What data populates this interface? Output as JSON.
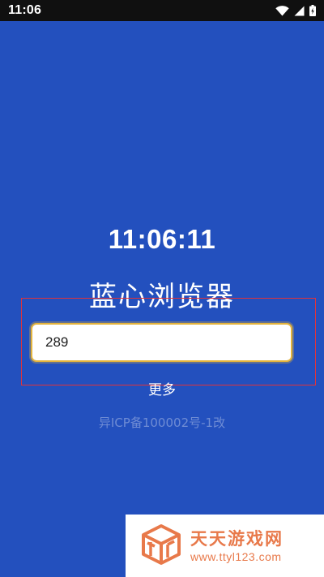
{
  "status_bar": {
    "time": "11:06",
    "icons": [
      "wifi-icon",
      "signal-icon",
      "battery-icon"
    ]
  },
  "main": {
    "clock": "11:06:11",
    "app_title": "蓝心浏览器",
    "search_value": "289",
    "more_label": "更多",
    "icp": "异ICP备100002号-1改"
  },
  "watermark": {
    "name": "天天游戏网",
    "url": "www.ttyl123.com"
  },
  "colors": {
    "background": "#2350BE",
    "status_bar": "#101010",
    "input_border": "#E3B33C",
    "highlight_box": "#E0333A",
    "watermark_text": "#E8794A"
  }
}
